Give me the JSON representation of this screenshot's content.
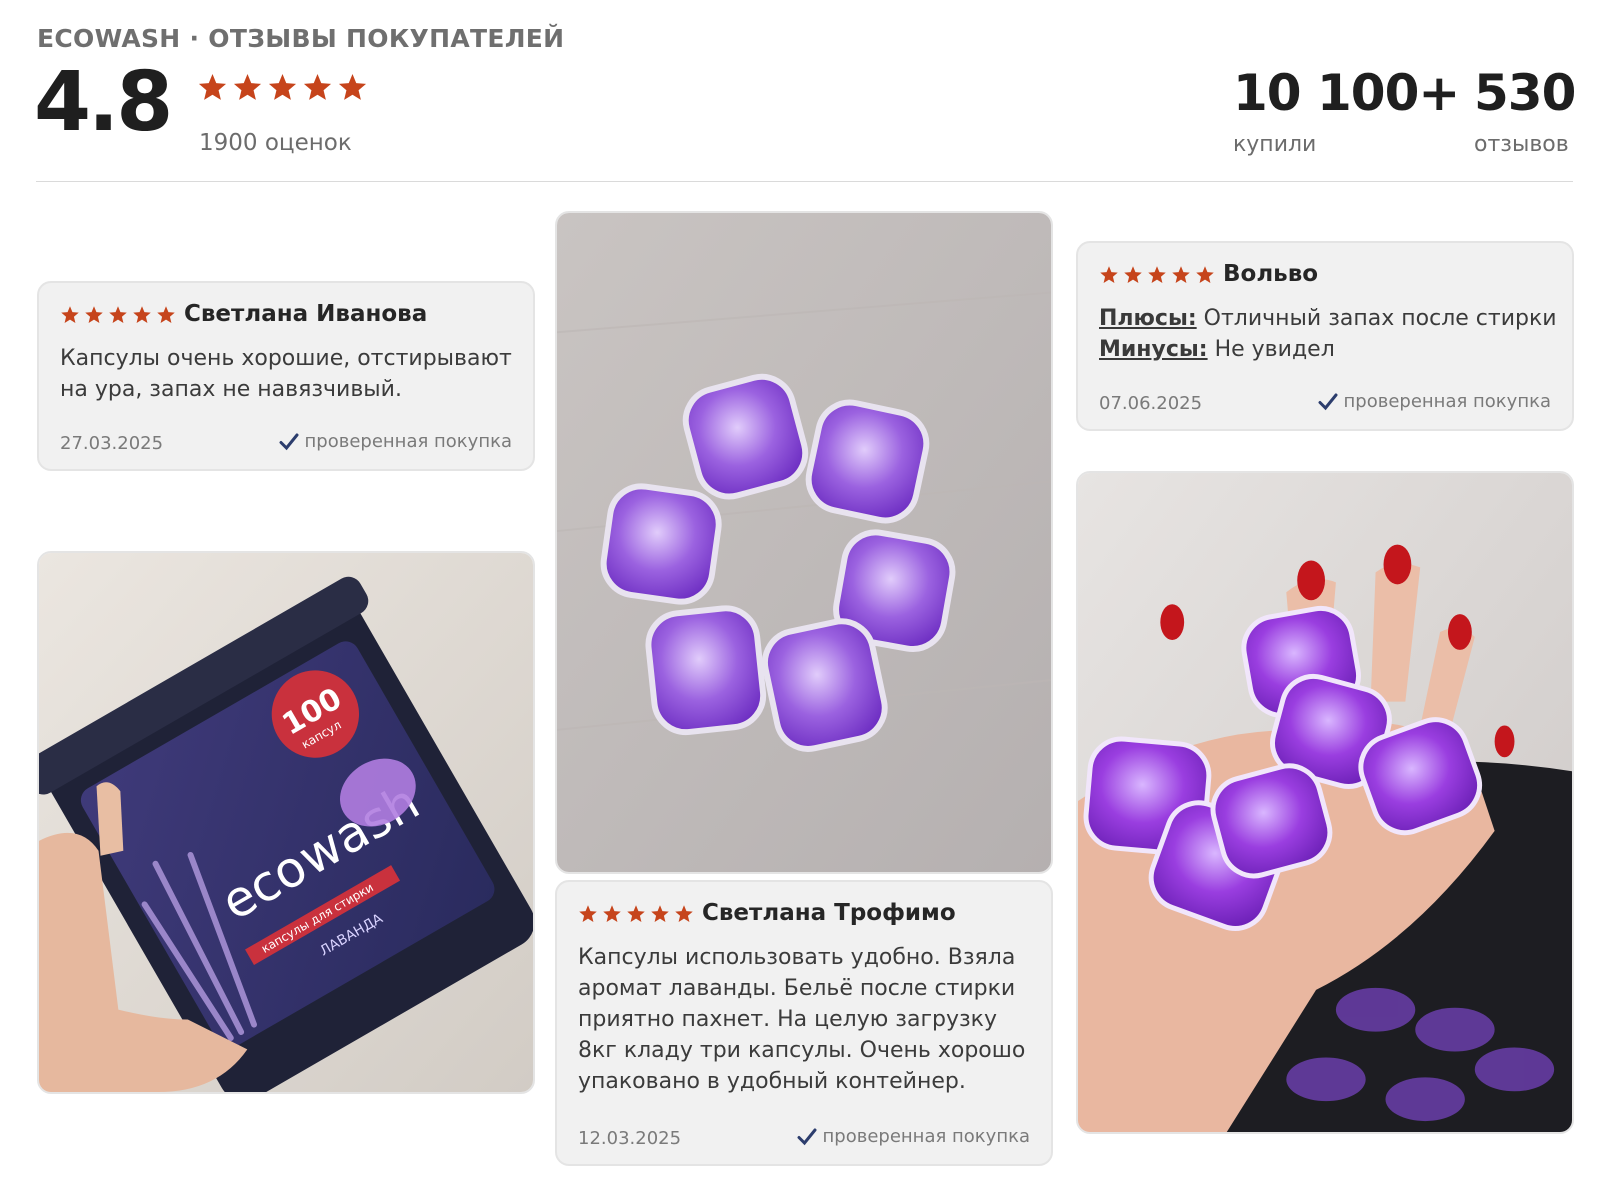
{
  "header": {
    "brand": "ECOWASH · ОТЗЫВЫ ПОКУПАТЕЛЕЙ",
    "rating": "4.8",
    "stars": 5,
    "rating_count": "1900 оценок",
    "bought_value": "10 100+",
    "bought_label": "купили",
    "reviews_value": "530",
    "reviews_label": "отзывов"
  },
  "colors": {
    "star": "#c6441b",
    "check": "#2c3d6d",
    "card_bg": "#f1f1f1"
  },
  "reviews": [
    {
      "author": "Светлана Иванова",
      "stars": 5,
      "text": "Капсулы очень хорошие, отстирывают на ура, запах не навязчивый.",
      "date": "27.03.2025",
      "verified": "проверенная покупка"
    },
    {
      "author": "Светлана Трофимо",
      "stars": 5,
      "text": "Капсулы использовать удобно. Взяла аромат лаванды. Бельё после стирки приятно пахнет. На целую загрузку 8кг кладу три капсулы. Очень хорошо упаковано в удобный контейнер.",
      "date": "12.03.2025",
      "verified": "проверенная покупка"
    },
    {
      "author": "Вольво",
      "stars": 5,
      "pros_label": "Плюсы:",
      "pros": "Отличный запах после стирки",
      "cons_label": "Минусы:",
      "cons": "Не увидел",
      "date": "07.06.2025",
      "verified": "проверенная покупка"
    }
  ],
  "product_label": {
    "count": "100",
    "unit": "капсул",
    "brand_eco": "eco",
    "brand_wash": "wash",
    "subtitle": "капсулы для стирки",
    "scent": "ЛАВАНДА"
  },
  "icons": [
    "star-icon",
    "check-icon"
  ]
}
